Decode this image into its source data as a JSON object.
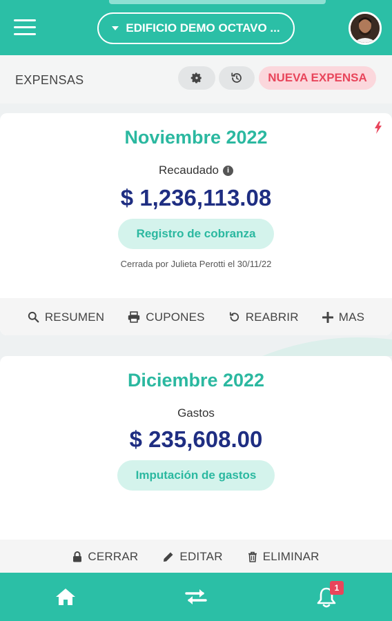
{
  "header": {
    "building": "EDIFICIO DEMO OCTAVO ..."
  },
  "subheader": {
    "title": "EXPENSAS",
    "new_button": "NUEVA EXPENSA"
  },
  "cards": [
    {
      "period": "Noviembre 2022",
      "label": "Recaudado",
      "amount": "$ 1,236,113.08",
      "pill": "Registro de cobranza",
      "note": "Cerrada por Julieta Perotti el 30/11/22",
      "actions": {
        "summary": "RESUMEN",
        "coupons": "CUPONES",
        "reopen": "REABRIR",
        "more": "MAS"
      }
    },
    {
      "period": "Diciembre 2022",
      "label": "Gastos",
      "amount": "$ 235,608.00",
      "pill": "Imputación de gastos",
      "actions": {
        "close": "CERRAR",
        "edit": "EDITAR",
        "delete": "ELIMINAR"
      }
    }
  ],
  "bottom_nav": {
    "notifications_count": "1"
  },
  "colors": {
    "accent": "#2bbfa6",
    "amount": "#1f2e82",
    "alert": "#e8455b"
  }
}
